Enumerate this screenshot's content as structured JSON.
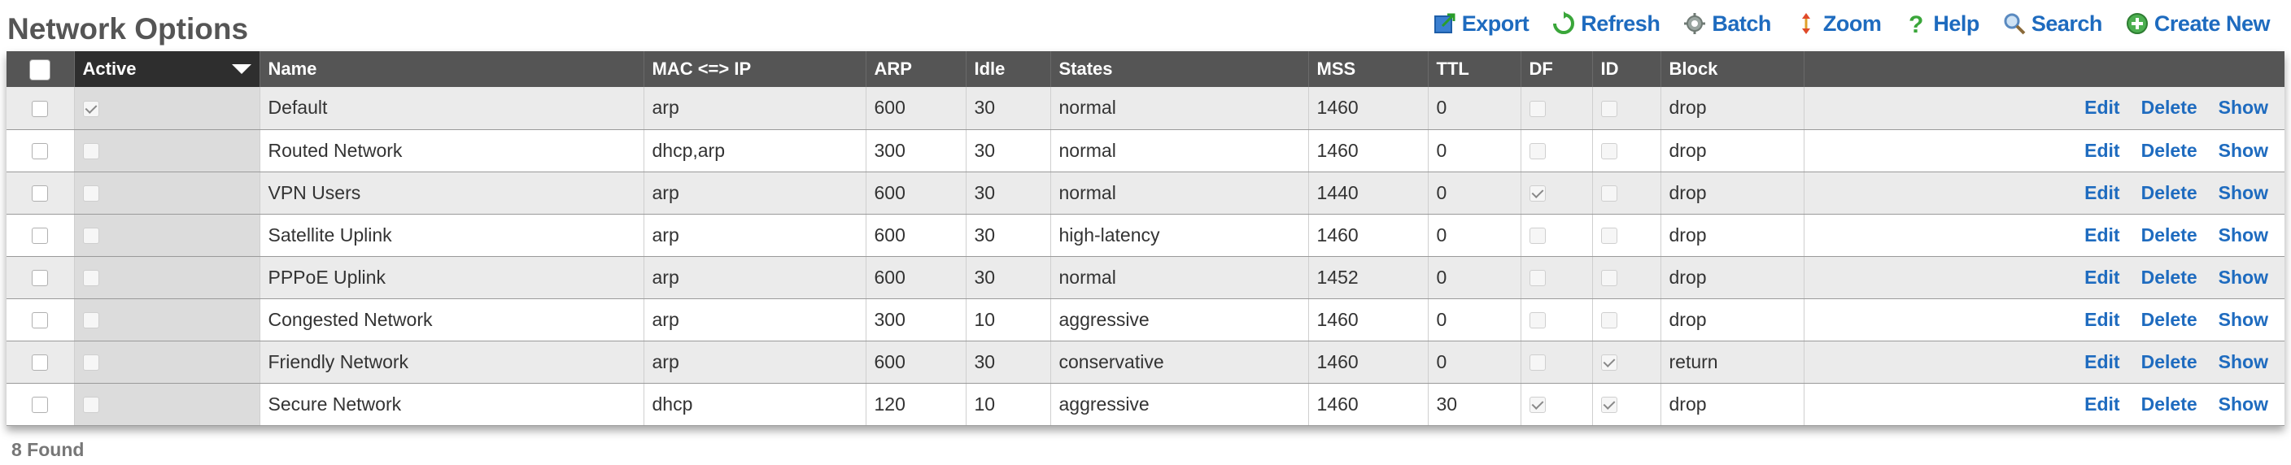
{
  "page": {
    "title": "Network Options"
  },
  "toolbar": [
    {
      "label": "Export",
      "icon": "export-icon"
    },
    {
      "label": "Refresh",
      "icon": "refresh-icon"
    },
    {
      "label": "Batch",
      "icon": "batch-icon"
    },
    {
      "label": "Zoom",
      "icon": "zoom-icon"
    },
    {
      "label": "Help",
      "icon": "help-icon"
    },
    {
      "label": "Search",
      "icon": "search-icon"
    },
    {
      "label": "Create New",
      "icon": "create-new-icon"
    }
  ],
  "columns": {
    "active": "Active",
    "name": "Name",
    "mac_ip": "MAC <=> IP",
    "arp": "ARP",
    "idle": "Idle",
    "states": "States",
    "mss": "MSS",
    "ttl": "TTL",
    "df": "DF",
    "id": "ID",
    "block": "Block"
  },
  "actions": {
    "edit": "Edit",
    "delete": "Delete",
    "show": "Show"
  },
  "rows": [
    {
      "active": true,
      "name": "Default",
      "mac_ip": "arp",
      "arp": "600",
      "idle": "30",
      "states": "normal",
      "mss": "1460",
      "ttl": "0",
      "df": false,
      "id": false,
      "block": "drop"
    },
    {
      "active": false,
      "name": "Routed Network",
      "mac_ip": "dhcp,arp",
      "arp": "300",
      "idle": "30",
      "states": "normal",
      "mss": "1460",
      "ttl": "0",
      "df": false,
      "id": false,
      "block": "drop"
    },
    {
      "active": false,
      "name": "VPN Users",
      "mac_ip": "arp",
      "arp": "600",
      "idle": "30",
      "states": "normal",
      "mss": "1440",
      "ttl": "0",
      "df": true,
      "id": false,
      "block": "drop"
    },
    {
      "active": false,
      "name": "Satellite Uplink",
      "mac_ip": "arp",
      "arp": "600",
      "idle": "30",
      "states": "high-latency",
      "mss": "1460",
      "ttl": "0",
      "df": false,
      "id": false,
      "block": "drop"
    },
    {
      "active": false,
      "name": "PPPoE Uplink",
      "mac_ip": "arp",
      "arp": "600",
      "idle": "30",
      "states": "normal",
      "mss": "1452",
      "ttl": "0",
      "df": false,
      "id": false,
      "block": "drop"
    },
    {
      "active": false,
      "name": "Congested Network",
      "mac_ip": "arp",
      "arp": "300",
      "idle": "10",
      "states": "aggressive",
      "mss": "1460",
      "ttl": "0",
      "df": false,
      "id": false,
      "block": "drop"
    },
    {
      "active": false,
      "name": "Friendly Network",
      "mac_ip": "arp",
      "arp": "600",
      "idle": "30",
      "states": "conservative",
      "mss": "1460",
      "ttl": "0",
      "df": false,
      "id": true,
      "block": "return"
    },
    {
      "active": false,
      "name": "Secure Network",
      "mac_ip": "dhcp",
      "arp": "120",
      "idle": "10",
      "states": "aggressive",
      "mss": "1460",
      "ttl": "30",
      "df": true,
      "id": true,
      "block": "drop"
    }
  ],
  "footer": {
    "count": "8 Found"
  },
  "colors": {
    "accent": "#1e6bbf",
    "header_bg": "#555555",
    "active_header_bg": "#2e2e2e"
  }
}
